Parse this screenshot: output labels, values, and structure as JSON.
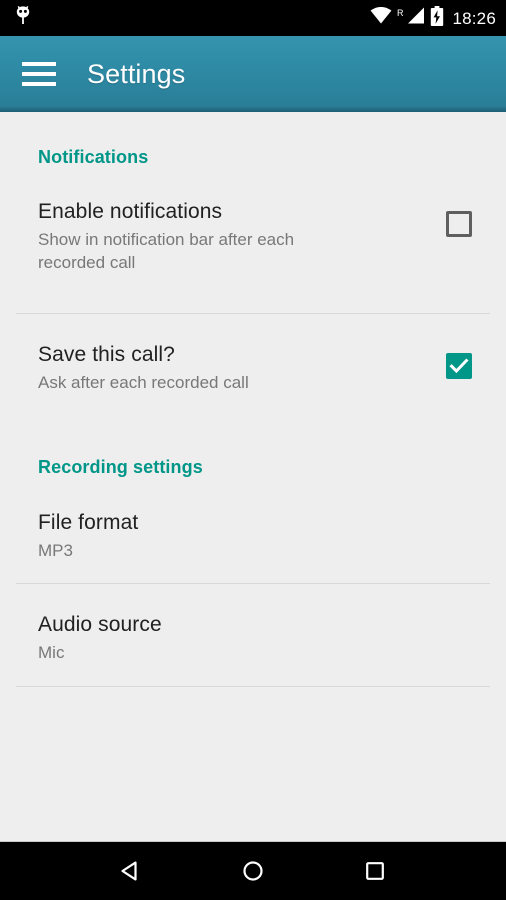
{
  "status_bar": {
    "notification_icon": "android-robot-icon",
    "wifi_icon": "wifi-icon",
    "roaming_label": "R",
    "signal_icon": "cellular-signal-icon",
    "battery_icon": "battery-charging-icon",
    "time": "18:26"
  },
  "toolbar": {
    "menu_icon": "hamburger-menu-icon",
    "title": "Settings",
    "background_color": "#2e8aa4"
  },
  "accent_color": "#009688",
  "sections": [
    {
      "header": "Notifications",
      "items": [
        {
          "title": "Enable notifications",
          "summary": "Show in notification bar after each recorded call",
          "widget": "checkbox",
          "checked": false
        },
        {
          "title": "Save this call?",
          "summary": "Ask after each recorded call",
          "widget": "checkbox",
          "checked": true
        }
      ]
    },
    {
      "header": "Recording settings",
      "items": [
        {
          "title": "File format",
          "summary": "MP3",
          "widget": "none"
        },
        {
          "title": "Audio source",
          "summary": "Mic",
          "widget": "none"
        }
      ]
    }
  ],
  "nav_bar": {
    "back_label": "back-button",
    "home_label": "home-button",
    "recents_label": "recents-button"
  }
}
